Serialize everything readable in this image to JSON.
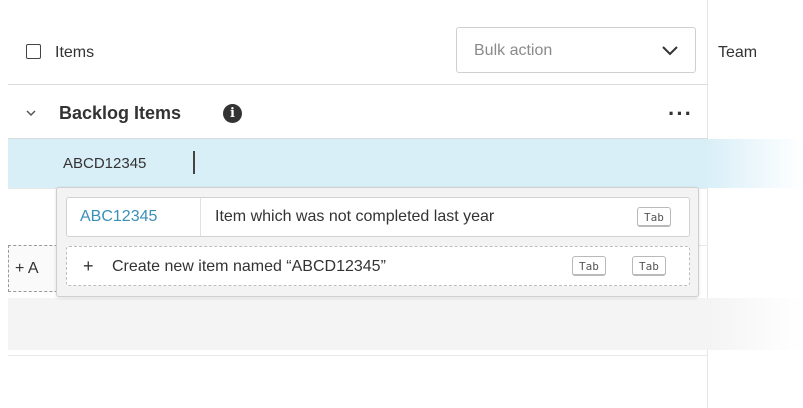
{
  "header": {
    "items_label": "Items",
    "bulk_action_placeholder": "Bulk action",
    "team_column": "Team"
  },
  "group": {
    "title": "Backlog Items"
  },
  "editing_row": {
    "value": "ABCD12345"
  },
  "autocomplete": {
    "suggestion": {
      "code": "ABC12345",
      "description": "Item which was not completed last year",
      "shortcut": "Tab"
    },
    "create_option": {
      "label": "Create new item named “ABCD12345”",
      "shortcuts": [
        "Tab",
        "Tab"
      ]
    }
  },
  "add_button": {
    "label": "+ A"
  },
  "colors": {
    "selected_row": "#d9eff8",
    "link": "#3a8fb7",
    "text": "#333333"
  },
  "icons": [
    "chevron-down-icon",
    "info-icon",
    "more-icon",
    "plus-icon"
  ]
}
